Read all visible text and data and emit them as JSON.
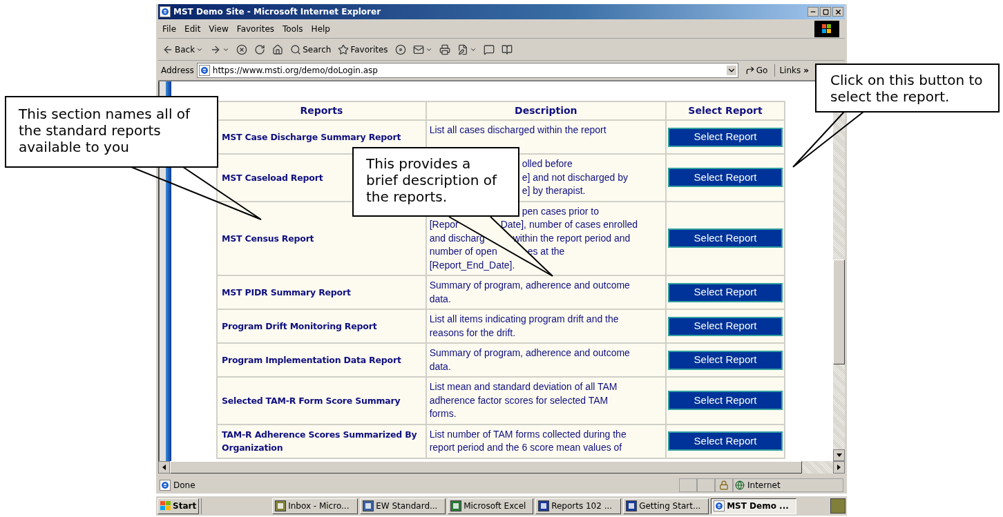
{
  "window": {
    "title": "MST Demo Site - Microsoft Internet Explorer"
  },
  "menu": [
    "File",
    "Edit",
    "View",
    "Favorites",
    "Tools",
    "Help"
  ],
  "toolbar": [
    {
      "kind": "back",
      "label": "Back",
      "has_menu": true
    },
    {
      "kind": "forward",
      "has_menu": true
    },
    {
      "kind": "stop",
      "has_menu": false
    },
    {
      "kind": "refresh",
      "has_menu": false
    },
    {
      "kind": "home",
      "has_menu": false
    },
    {
      "kind": "search",
      "label": "Search",
      "has_menu": false
    },
    {
      "kind": "favorites",
      "label": "Favorites",
      "has_menu": false
    },
    {
      "kind": "media",
      "has_menu": false
    },
    {
      "kind": "mail",
      "has_menu": true
    },
    {
      "kind": "print",
      "has_menu": false
    },
    {
      "kind": "edit",
      "has_menu": true
    },
    {
      "kind": "discuss",
      "has_menu": false
    },
    {
      "kind": "research",
      "has_menu": false
    }
  ],
  "address": {
    "label": "Address",
    "value": "https://www.msti.org/demo/doLogin.asp",
    "go": "Go",
    "links": "Links",
    "more": "»"
  },
  "table": {
    "columns": [
      "Reports",
      "Description",
      "Select Report"
    ],
    "rows": [
      {
        "name": "MST Case Discharge Summary Report",
        "description": [
          {
            "segments": [
              "List all cases discharged within the report"
            ],
            "covered_start": false
          }
        ],
        "button": "Select Report"
      },
      {
        "name": "MST Caseload Report",
        "description": [
          {
            "segments": [
              "olled before"
            ],
            "covered_start": true
          },
          {
            "segments": [
              "e] and not discharged by"
            ],
            "covered_start": true
          },
          {
            "segments": [
              "e] by therapist."
            ],
            "covered_start": true
          }
        ],
        "button": "Select Report"
      },
      {
        "name": "MST Census Report",
        "description": [
          {
            "segments": [
              "pen cases prior to"
            ],
            "covered_start": true
          },
          {
            "segments": [
              "[Repor",
              "Date], number of cases enrolled"
            ],
            "covered_start": false
          },
          {
            "segments": [
              "and discharg",
              "within the report period and"
            ],
            "covered_start": false
          },
          {
            "segments": [
              "number of open",
              "es at the"
            ],
            "covered_start": false
          },
          {
            "segments": [
              "[Report_End_Date]."
            ],
            "covered_start": false
          }
        ],
        "button": "Select Report"
      },
      {
        "name": "MST PIDR Summary Report",
        "description": [
          {
            "segments": [
              "Summary of program, adherence and outcome"
            ],
            "covered_start": false
          },
          {
            "segments": [
              "data."
            ],
            "covered_start": false
          }
        ],
        "button": "Select Report"
      },
      {
        "name": "Program Drift Monitoring Report",
        "description": [
          {
            "segments": [
              "List all items indicating program drift and the"
            ],
            "covered_start": false
          },
          {
            "segments": [
              "reasons for the drift."
            ],
            "covered_start": false
          }
        ],
        "button": "Select Report"
      },
      {
        "name": "Program Implementation Data Report",
        "description": [
          {
            "segments": [
              "Summary of program, adherence and outcome"
            ],
            "covered_start": false
          },
          {
            "segments": [
              "data."
            ],
            "covered_start": false
          }
        ],
        "button": "Select Report"
      },
      {
        "name": "Selected TAM-R Form Score Summary",
        "description": [
          {
            "segments": [
              "List mean and standard deviation of all TAM"
            ],
            "covered_start": false
          },
          {
            "segments": [
              "adherence factor scores for selected TAM"
            ],
            "covered_start": false
          },
          {
            "segments": [
              "forms."
            ],
            "covered_start": false
          }
        ],
        "button": "Select Report"
      },
      {
        "name": "TAM-R Adherence Scores Summarized By Organization",
        "description": [
          {
            "segments": [
              "List number of TAM forms collected during the"
            ],
            "covered_start": false
          },
          {
            "segments": [
              "report period and the 6 score mean values of"
            ],
            "covered_start": false
          }
        ],
        "button": "Select Report"
      }
    ]
  },
  "status_bar": {
    "text": "Done",
    "zone": "Internet"
  },
  "taskbar": {
    "start": "Start",
    "items": [
      {
        "label": "Inbox - Micro...",
        "kind": "mail",
        "selected": false
      },
      {
        "label": "EW Standard...",
        "kind": "search",
        "selected": false
      },
      {
        "label": "Microsoft Excel",
        "kind": "excel",
        "selected": false
      },
      {
        "label": "Reports 102 ...",
        "kind": "word",
        "selected": false
      },
      {
        "label": "Getting Start...",
        "kind": "word",
        "selected": false
      },
      {
        "label": "MST Demo ...",
        "kind": "browser",
        "selected": true
      }
    ]
  },
  "callouts": [
    {
      "text": "This section names all of the standard reports available to you"
    },
    {
      "text": "This provides a brief description of the reports."
    },
    {
      "text": "Click on this button to select the report."
    }
  ]
}
